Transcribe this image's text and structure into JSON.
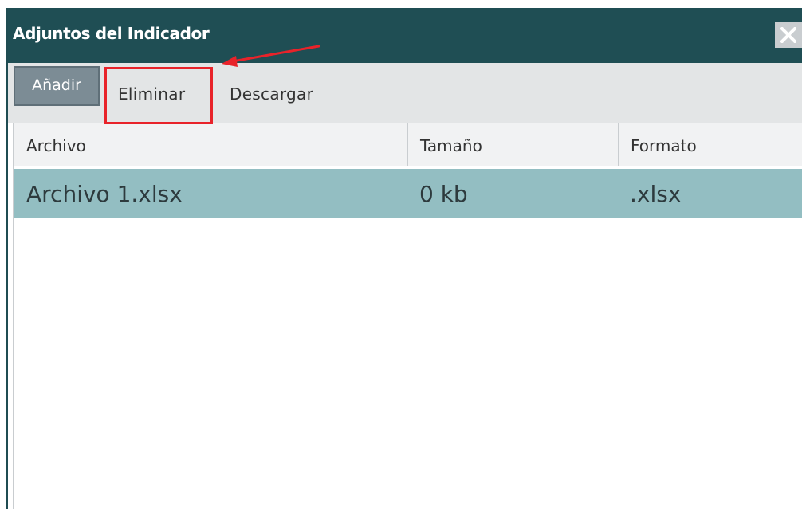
{
  "dialog": {
    "title": "Adjuntos del Indicador",
    "close_icon": "close-icon",
    "colors": {
      "titlebar": "#1f4e54",
      "toolbar": "#e3e5e6",
      "selected_row": "#93bec2",
      "highlight": "#e8232a"
    }
  },
  "toolbar": {
    "add_label": "Añadir",
    "delete_label": "Eliminar",
    "download_label": "Descargar"
  },
  "grid": {
    "columns": [
      "Archivo",
      "Tamaño",
      "Formato"
    ],
    "rows": [
      {
        "file": "Archivo 1.xlsx",
        "size": "0 kb",
        "format": ".xlsx",
        "selected": true
      }
    ]
  },
  "annotation": {
    "type": "red-arrow-and-box",
    "target": "delete-button"
  }
}
